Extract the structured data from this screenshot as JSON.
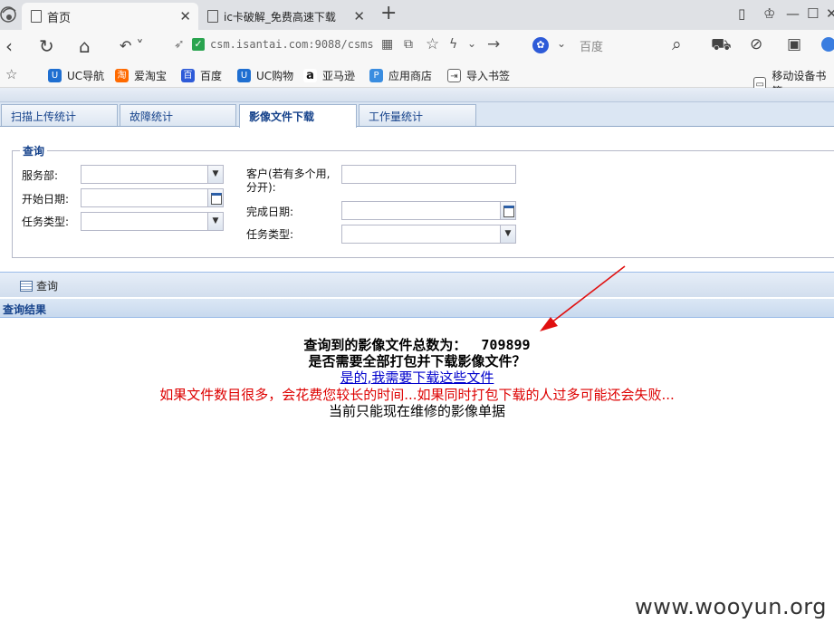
{
  "browser": {
    "tabs": [
      {
        "label": "首页"
      },
      {
        "label": "ic卡破解_免费高速下载"
      }
    ],
    "new_tab_label": "+",
    "url": "csm.isantai.com:9088/csms",
    "search_engine": "百度",
    "bookmarks": [
      {
        "label": "UC导航",
        "color": "#1f6fd1",
        "glyph": "U"
      },
      {
        "label": "爱淘宝",
        "color": "#ff6a00",
        "glyph": "淘"
      },
      {
        "label": "百度",
        "color": "#2e5bd8",
        "glyph": "百"
      },
      {
        "label": "UC购物",
        "color": "#1f6fd1",
        "glyph": "U"
      },
      {
        "label": "亚马逊",
        "color": "#ffffff",
        "glyph": "a"
      },
      {
        "label": "应用商店",
        "color": "#3a8de0",
        "glyph": "P"
      },
      {
        "label": "导入书签",
        "color": "#ffffff",
        "glyph": "⇥"
      }
    ],
    "mobile_bookmarks": "移动设备书签"
  },
  "app": {
    "tabs": [
      {
        "label": "扫描上传统计"
      },
      {
        "label": "故障统计"
      },
      {
        "label": "影像文件下载"
      },
      {
        "label": "工作量统计"
      }
    ],
    "query": {
      "legend": "查询",
      "fields_left": [
        {
          "label": "服务部:",
          "type": "select",
          "value": ""
        },
        {
          "label": "开始日期:",
          "type": "date",
          "value": ""
        },
        {
          "label": "任务类型:",
          "type": "select",
          "value": ""
        }
      ],
      "fields_right": [
        {
          "label": "客户(若有多个用,分开):",
          "type": "text",
          "value": ""
        },
        {
          "label": "完成日期:",
          "type": "date",
          "value": ""
        },
        {
          "label": "任务类型:",
          "type": "select",
          "value": ""
        }
      ]
    },
    "toolbar": {
      "query_label": "查询"
    },
    "results": {
      "header": "查询结果",
      "total_label": "查询到的影像文件总数为：",
      "total_value": "709899",
      "ask": "是否需要全部打包并下载影像文件？",
      "link": "是的,我需要下载这些文件",
      "warning": "如果文件数目很多，会花费您较长的时间...如果同时打包下载的人过多可能还会失败...",
      "note": "当前只能现在维修的影像单据"
    }
  },
  "watermark": "www.wooyun.org"
}
